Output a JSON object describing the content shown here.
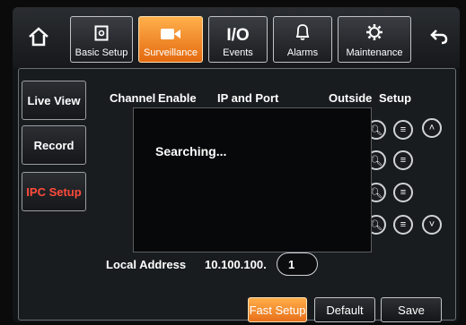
{
  "nav": {
    "home_icon": "home-icon",
    "back_icon": "back-arrow-icon",
    "tabs": [
      {
        "label": "Basic Setup",
        "icon": "document-icon"
      },
      {
        "label": "Surveillance",
        "icon": "camera-icon"
      },
      {
        "label": "Events",
        "icon_text": "I/O"
      },
      {
        "label": "Alarms",
        "icon": "bell-icon"
      },
      {
        "label": "Maintenance",
        "icon": "gear-icon"
      }
    ]
  },
  "sidebar": {
    "items": [
      {
        "label": "Live View"
      },
      {
        "label": "Record"
      },
      {
        "label": "IPC Setup"
      }
    ]
  },
  "table": {
    "headers": [
      "Channel",
      "Enable",
      "IP and Port",
      "Outside",
      "Setup"
    ]
  },
  "dialog": {
    "message": "Searching..."
  },
  "form": {
    "local_address_label": "Local Address",
    "local_address_prefix": "10.100.100.",
    "local_address_value": "1"
  },
  "buttons": {
    "fast_setup": "Fast Setup",
    "default": "Default",
    "save": "Save"
  },
  "colors": {
    "accent": "#f08a2c",
    "selected_text": "#ff4b3a"
  }
}
